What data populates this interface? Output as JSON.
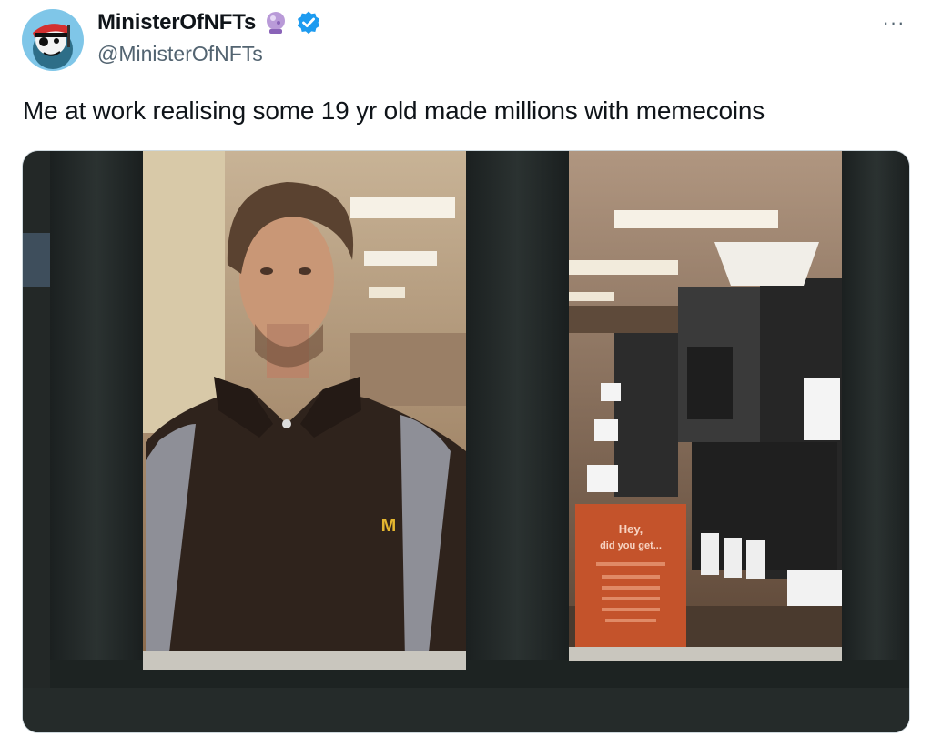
{
  "tweet": {
    "author": {
      "display_name": "MinisterOfNFTs",
      "handle": "@MinisterOfNFTs",
      "emoji_badge_icon": "crystal-ball-icon",
      "verified_icon": "verified-badge-icon"
    },
    "more_icon": "more-options-icon",
    "more_glyph": "···",
    "text": "Me at work realising some 19 yr old made millions with memecoins",
    "media": {
      "sign_line1": "Hey,",
      "sign_line2": "did you get...",
      "shirt_logo": "M"
    }
  },
  "colors": {
    "text_primary": "#0f1419",
    "text_secondary": "#536471",
    "verified_blue": "#1d9bf0",
    "avatar_bg": "#7fc6e8"
  }
}
